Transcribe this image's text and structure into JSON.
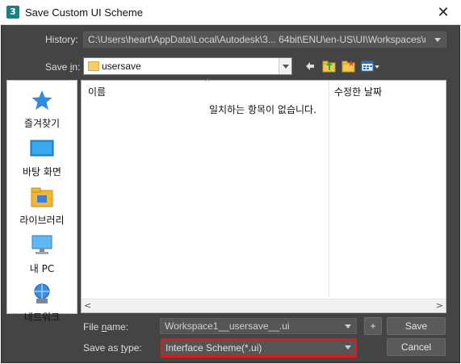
{
  "window": {
    "title": "Save Custom UI Scheme",
    "app_icon_text": "3",
    "close_glyph": "✕"
  },
  "history": {
    "label_prefix": "",
    "label": "History:",
    "value": "C:\\Users\\heart\\AppData\\Local\\Autodesk\\3... 64bit\\ENU\\en-US\\UI\\Workspaces\\usersave"
  },
  "save_in": {
    "label_pre": "Save ",
    "label_mnemonic": "i",
    "label_post": "n:",
    "folder": "usersave"
  },
  "toolbar": {
    "icons": [
      "back-arrow-icon",
      "up-folder-icon",
      "new-folder-icon",
      "view-menu-icon"
    ]
  },
  "places": [
    {
      "label": "즐겨찾기",
      "icon": "star-icon"
    },
    {
      "label": "바탕 화면",
      "icon": "desktop-icon"
    },
    {
      "label": "라이브러리",
      "icon": "library-icon"
    },
    {
      "label": "내 PC",
      "icon": "computer-icon"
    },
    {
      "label": "네트워크",
      "icon": "network-icon"
    }
  ],
  "file_list": {
    "columns": [
      "이름",
      "수정한 날짜"
    ],
    "empty_message": "일치하는 항목이 없습니다."
  },
  "file_name": {
    "label_pre": "File ",
    "label_mnemonic": "n",
    "label_post": "ame:",
    "value": "Workspace1__usersave__.ui"
  },
  "save_type": {
    "label_pre": "Save as ",
    "label_mnemonic": "t",
    "label_post": "ype:",
    "value": "Interface Scheme(*.ui)"
  },
  "buttons": {
    "plus": "+",
    "save": "Save",
    "cancel": "Cancel"
  },
  "colors": {
    "dialog_bg": "#444444",
    "highlight": "#e01a1a"
  }
}
